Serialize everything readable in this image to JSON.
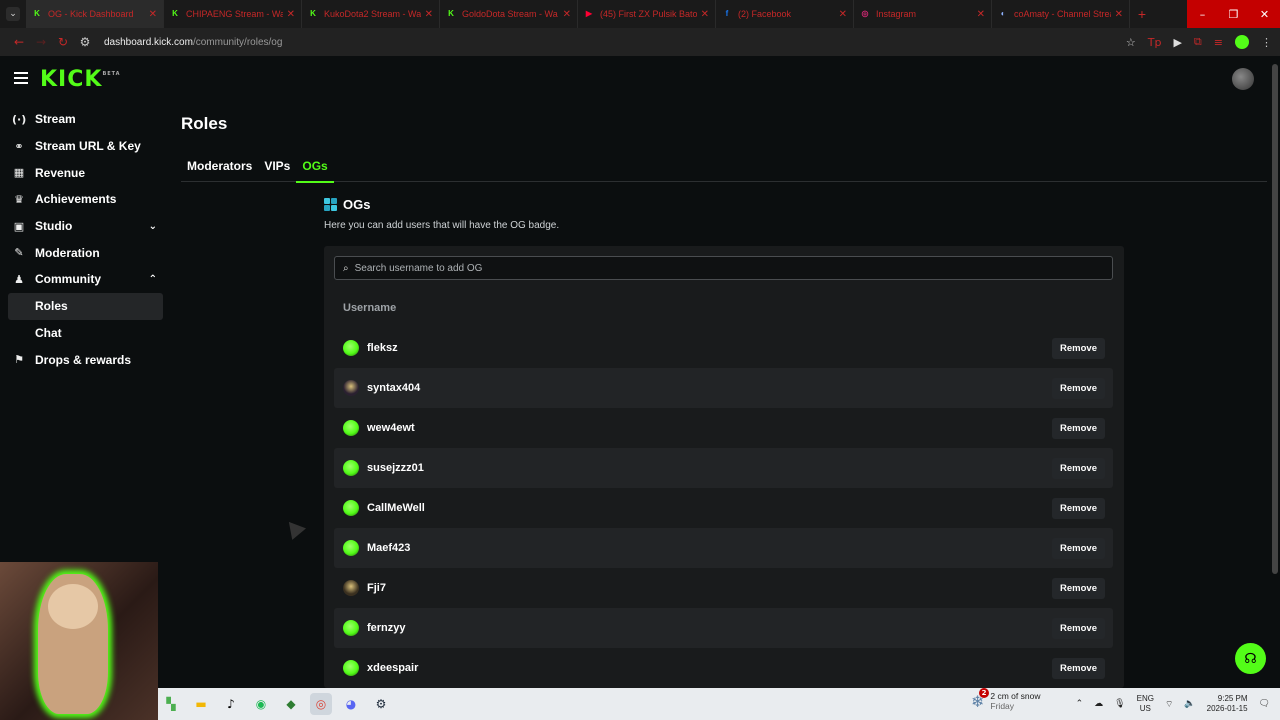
{
  "browser": {
    "tabs": [
      {
        "title": "OG - Kick Dashboard",
        "fav": "K",
        "fav_color": "#53fc18",
        "active": true
      },
      {
        "title": "CHIPAENG Stream - Wa",
        "fav": "K",
        "fav_color": "#53fc18",
        "active": false
      },
      {
        "title": "KukoDota2 Stream - Wa",
        "fav": "K",
        "fav_color": "#53fc18",
        "active": false
      },
      {
        "title": "GoldoDota Stream - Wa",
        "fav": "K",
        "fav_color": "#53fc18",
        "active": false
      },
      {
        "title": "(45) First ZX Pulsik Bato",
        "fav": "▶",
        "fav_color": "#ff0033",
        "active": false
      },
      {
        "title": "(2) Facebook",
        "fav": "f",
        "fav_color": "#1877f2",
        "active": false
      },
      {
        "title": "Instagram",
        "fav": "◎",
        "fav_color": "#d62976",
        "active": false
      },
      {
        "title": "coAmaty - Channel Strea",
        "fav": "◐",
        "fav_color": "#8fb3ff",
        "active": false
      }
    ],
    "url_domain": "dashboard.kick.com",
    "url_path": "/community/roles/og"
  },
  "header": {
    "logo": "KICK",
    "logo_badge": "BETA"
  },
  "sidebar": {
    "items": [
      {
        "label": "Stream",
        "icon": "stream-icon",
        "glyph": "(·)"
      },
      {
        "label": "Stream URL & Key",
        "icon": "link-icon",
        "glyph": "⚭"
      },
      {
        "label": "Revenue",
        "icon": "revenue-icon",
        "glyph": "▦"
      },
      {
        "label": "Achievements",
        "icon": "trophy-icon",
        "glyph": "♛"
      },
      {
        "label": "Studio",
        "icon": "studio-icon",
        "glyph": "▣",
        "chevron": "⌄"
      },
      {
        "label": "Moderation",
        "icon": "wrench-icon",
        "glyph": "✎"
      },
      {
        "label": "Community",
        "icon": "community-icon",
        "glyph": "♟",
        "chevron": "⌃"
      }
    ],
    "sub_items": [
      {
        "label": "Roles",
        "active": true
      },
      {
        "label": "Chat",
        "active": false
      }
    ],
    "last_item": {
      "label": "Drops & rewards",
      "icon": "drops-icon",
      "glyph": "⚑"
    }
  },
  "main": {
    "title": "Roles",
    "tabs": [
      {
        "label": "Moderators",
        "active": false
      },
      {
        "label": "VIPs",
        "active": false
      },
      {
        "label": "OGs",
        "active": true
      }
    ],
    "section_title": "OGs",
    "section_desc": "Here you can add users that will have the OG badge.",
    "search_placeholder": "Search username to add OG",
    "column_header": "Username",
    "remove_label": "Remove",
    "users": [
      {
        "name": "fleksz",
        "avatar_color": "#53fc18"
      },
      {
        "name": "syntax404",
        "avatar_color": "#2a2030"
      },
      {
        "name": "wew4ewt",
        "avatar_color": "#53fc18"
      },
      {
        "name": "susejzzz01",
        "avatar_color": "#53fc18"
      },
      {
        "name": "CallMeWell",
        "avatar_color": "#53fc18"
      },
      {
        "name": "Maef423",
        "avatar_color": "#53fc18"
      },
      {
        "name": "Fji7",
        "avatar_color": "#3a3020"
      },
      {
        "name": "fernzyy",
        "avatar_color": "#53fc18"
      },
      {
        "name": "xdeespair",
        "avatar_color": "#53fc18"
      }
    ]
  },
  "taskbar": {
    "weather_badge": "2",
    "weather_text": "2 cm of snow",
    "weather_day": "Friday",
    "lang_1": "ENG",
    "lang_2": "US",
    "time": "9:25 PM",
    "date": "2026-01-15"
  },
  "colors": {
    "accent": "#53fc18",
    "background": "#0b0e0f",
    "panel": "#191b1c"
  }
}
